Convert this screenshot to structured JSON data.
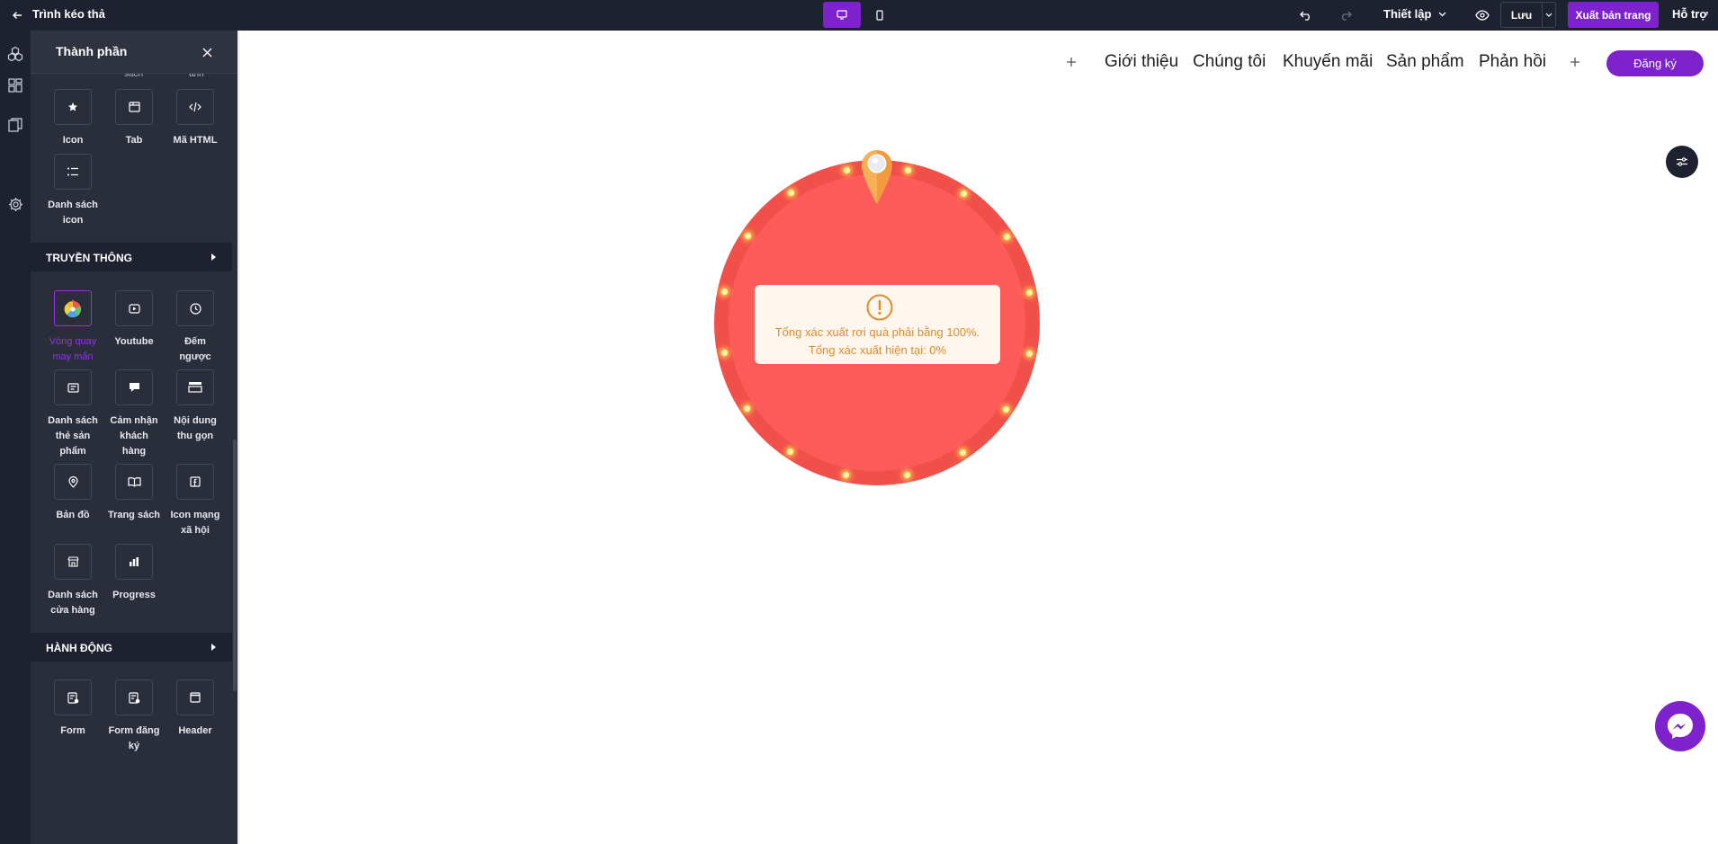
{
  "topbar": {
    "title": "Trình kéo thả",
    "settings_label": "Thiết lập",
    "save_label": "Lưu",
    "publish_label": "Xuất bản trang",
    "support_label": "Hỗ trợ"
  },
  "panel": {
    "title": "Thành phần",
    "cut_off_labels": [
      "sách",
      "ảnh"
    ],
    "basic_items": [
      {
        "label": "Icon",
        "icon": "star-icon"
      },
      {
        "label": "Tab",
        "icon": "tab-icon"
      },
      {
        "label": "Mã HTML",
        "icon": "code-icon"
      },
      {
        "label": "Danh sách icon",
        "icon": "list-icon"
      }
    ],
    "sections": [
      {
        "title": "TRUYỀN THÔNG"
      },
      {
        "title": "HÀNH ĐỘNG"
      }
    ],
    "media_items": [
      {
        "label": "Vòng quay may mắn",
        "icon": "lucky-wheel-icon",
        "active": true
      },
      {
        "label": "Youtube",
        "icon": "youtube-icon"
      },
      {
        "label": "Đếm ngược",
        "icon": "clock-icon"
      },
      {
        "label": "Danh sách thẻ sản phẩm",
        "icon": "product-card-icon"
      },
      {
        "label": "Cảm nhận khách hàng",
        "icon": "testimonial-icon"
      },
      {
        "label": "Nội dung thu gọn",
        "icon": "accordion-icon"
      },
      {
        "label": "Bản đồ",
        "icon": "map-pin-icon"
      },
      {
        "label": "Trang sách",
        "icon": "book-icon"
      },
      {
        "label": "Icon mạng xã hội",
        "icon": "facebook-icon"
      },
      {
        "label": "Danh sách cửa hàng",
        "icon": "store-icon"
      },
      {
        "label": "Progress",
        "icon": "bar-chart-icon"
      }
    ],
    "action_items": [
      {
        "label": "Form",
        "icon": "form-icon"
      },
      {
        "label": "Form đăng ký",
        "icon": "form-register-icon"
      },
      {
        "label": "Header",
        "icon": "header-icon"
      }
    ]
  },
  "canvas": {
    "nav_items": [
      "Giới thiệu",
      "Chúng tôi",
      "Khuyến mãi",
      "Sản phẩm",
      "Phản hồi"
    ],
    "signup_label": "Đăng ký",
    "warning": {
      "line1": "Tổng xác xuất rơi quà phải bằng 100%.",
      "line2": "Tổng xác xuất hiện tại: 0%"
    }
  },
  "colors": {
    "accent": "#7e22ce",
    "topbar_bg": "#1e2230",
    "panel_bg": "#2a2e3a",
    "wheel_outer": "#f1504a",
    "wheel_inner": "#fd5b5a",
    "warning_text": "#e08a2a"
  }
}
